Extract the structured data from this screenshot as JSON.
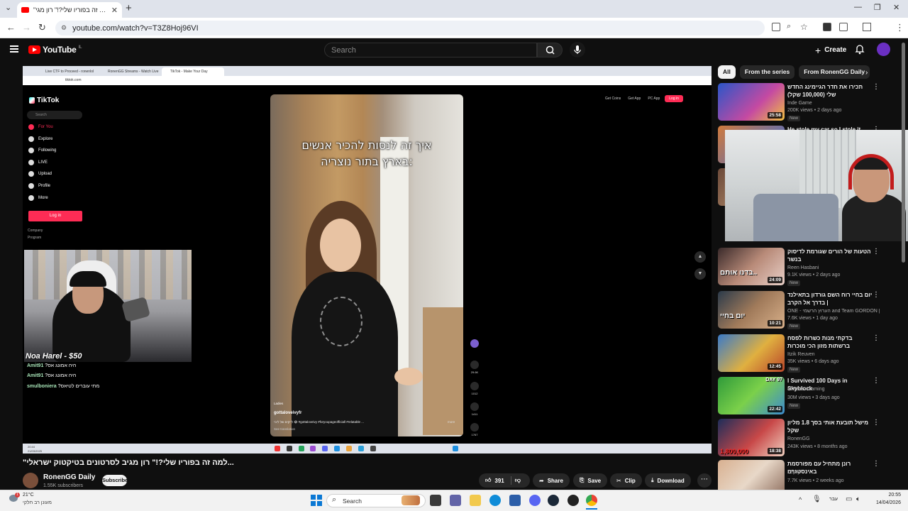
{
  "browser": {
    "tab_title": "\"למה זה בפוריו שלי?!\" רון מגי...",
    "url": "youtube.com/watch?v=T3Z8Hoj96VI"
  },
  "youtube": {
    "logo_text": "YouTube",
    "logo_country": "IL",
    "search_placeholder": "Search",
    "create_label": "Create"
  },
  "player": {
    "inner_tabs": [
      "Live CTF to Proceed - ronenlol",
      "RonenGG Streams - Watch Live",
      "TikTok - Make Your Day"
    ],
    "inner_url": "tiktok.com",
    "tiktok": {
      "logo": "TikTok",
      "search": "Search",
      "nav": [
        "For You",
        "Explore",
        "Following",
        "LIVE",
        "Upload",
        "Profile",
        "More"
      ],
      "login_button": "Log in",
      "footer": [
        "Company",
        "Program"
      ],
      "top_buttons": [
        "Get Coins",
        "Get App",
        "PC App"
      ],
      "top_login": "Log in",
      "caption_line1": "איך זה לנסות להכיר אנשים",
      "caption_line2": "בארץ בתור נוצריה:",
      "user": "gottaloveivyfr",
      "label": "Ladies",
      "description": "לייקים של ליבי 😂 #gottaloveivy #foryoupageofficiall #relatable ...",
      "see_translation": "See translation",
      "more": "more",
      "actions": [
        {
          "name": "like",
          "count": "29.6K"
        },
        {
          "name": "comment",
          "count": "1012"
        },
        {
          "name": "save",
          "count": "1411"
        },
        {
          "name": "share",
          "count": "1767"
        }
      ]
    },
    "donation": "Noa Harel - $50",
    "chat": [
      {
        "user": "Amit91",
        "msg": "?היה אמונג אס"
      },
      {
        "user": "Amit91",
        "msg": "?היה אמונג אס"
      },
      {
        "user": "smulboniera",
        "msg": "?מתי עוברים לטיאס"
      }
    ],
    "inner_clock": [
      "20:44",
      "21/03/2025"
    ]
  },
  "video": {
    "title": "\"למה זה בפוריו שלי?!\" רון מגיב לסרטונים בטיקטוק ישראלי...",
    "channel": "RonenGG Daily",
    "subscribers": "1.55K subscribers",
    "subscribe": "Subscribe",
    "likes": "391",
    "share": "Share",
    "save": "Save",
    "clip": "Clip",
    "download": "Download"
  },
  "sidebar": {
    "chips": [
      "All",
      "From the series",
      "From RonenGG Daily"
    ],
    "recommendations": [
      {
        "title": "תכירו את חדר הגיימינג החדש שלי (100,000 שקל)",
        "channel": "Inde Game",
        "stats": "200K views • 2 days ago",
        "badge": "New",
        "duration": "25:58"
      },
      {
        "title": "He stole my car so I stole it back",
        "channel": "",
        "stats": "",
        "badge": "",
        "duration": ""
      },
      {
        "title": "",
        "channel": "",
        "stats": "",
        "badge": "",
        "duration": ""
      },
      {
        "title": "הטעות של הורים שגורמת לדיסוק בנשר",
        "channel": "Reen Hasbani",
        "stats": "9.1K views • 2 days ago",
        "badge": "New",
        "duration": "24:09",
        "overlay": "בדנו אותם.."
      },
      {
        "title": "יום בחיי רוח השם גורדון בתאילנד | בדרך אל הקרב",
        "channel": "ONE - הערוץ הרשמי and Team GORDON | ...",
        "stats": "7.6K views • 1 day ago",
        "badge": "New",
        "duration": "10:21",
        "overlay": "יום בחיי"
      },
      {
        "title": "בדקתי מנות כשרות לפסח ברשתות מזון הכי מוכרות בישראל!",
        "channel": "Itzik Reuven",
        "stats": "35K views • 6 days ago",
        "badge": "New",
        "duration": "12:45"
      },
      {
        "title": "I Survived 100 Days in Skyblock",
        "channel": "MrBeast Gaming",
        "stats": "30M views • 3 days ago",
        "badge": "New",
        "duration": "22:42",
        "overlay": "DAY 97"
      },
      {
        "title": "מישל תובעת אותי בסך 1.8 מליון שקל",
        "channel": "RonenGG",
        "stats": "243K views • 8 months ago",
        "badge": "",
        "duration": "18:38",
        "overlay": "1,800,000"
      },
      {
        "title": "רונן מתחיל עם מפורסמת באינסטגרם",
        "channel": "Zepry",
        "stats": "7.7K views • 2 weeks ago",
        "badge": "",
        "duration": ""
      }
    ]
  },
  "taskbar": {
    "temp": "21°C",
    "weather": "מעונן רב חלקי",
    "search": "Search",
    "lang": "עבר",
    "time": "20:55",
    "date": "14/04/2026"
  },
  "colors": {
    "youtube_red": "#ff0000",
    "tiktok_pink": "#fe2c55",
    "bg": "#0f0f0f"
  }
}
